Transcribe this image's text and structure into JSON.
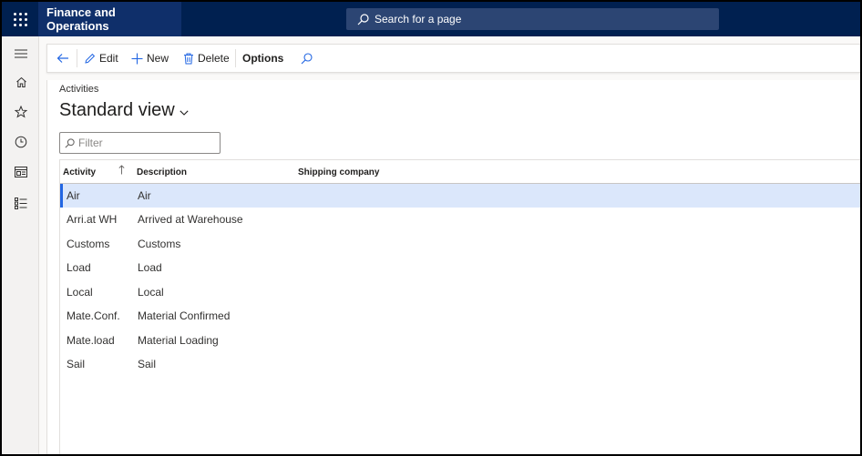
{
  "app": {
    "title": "Finance and Operations"
  },
  "search": {
    "placeholder": "Search for a page"
  },
  "nav": {
    "icons": [
      "hamburger-icon",
      "home-icon",
      "star-icon",
      "clock-icon",
      "workspace-icon",
      "list-icon"
    ]
  },
  "actions": {
    "edit": "Edit",
    "new": "New",
    "delete": "Delete",
    "options": "Options"
  },
  "page": {
    "breadcrumb": "Activities",
    "view_title": "Standard view",
    "filter_placeholder": "Filter"
  },
  "grid": {
    "columns": [
      "Activity",
      "Description",
      "Shipping company"
    ],
    "rows": [
      {
        "activity": "Air",
        "description": "Air",
        "shipping": ""
      },
      {
        "activity": "Arri.at WH",
        "description": "Arrived at Warehouse",
        "shipping": ""
      },
      {
        "activity": "Customs",
        "description": "Customs",
        "shipping": ""
      },
      {
        "activity": "Load",
        "description": "Load",
        "shipping": ""
      },
      {
        "activity": "Local",
        "description": "Local",
        "shipping": ""
      },
      {
        "activity": "Mate.Conf.",
        "description": "Material Confirmed",
        "shipping": ""
      },
      {
        "activity": "Mate.load",
        "description": "Material Loading",
        "shipping": ""
      },
      {
        "activity": "Sail",
        "description": "Sail",
        "shipping": ""
      }
    ],
    "selected_index": 0
  },
  "colors": {
    "topbar": "#002050",
    "title_bg": "#0f2f6a",
    "accent": "#2266e3",
    "selected_row": "#dbe7fb"
  }
}
